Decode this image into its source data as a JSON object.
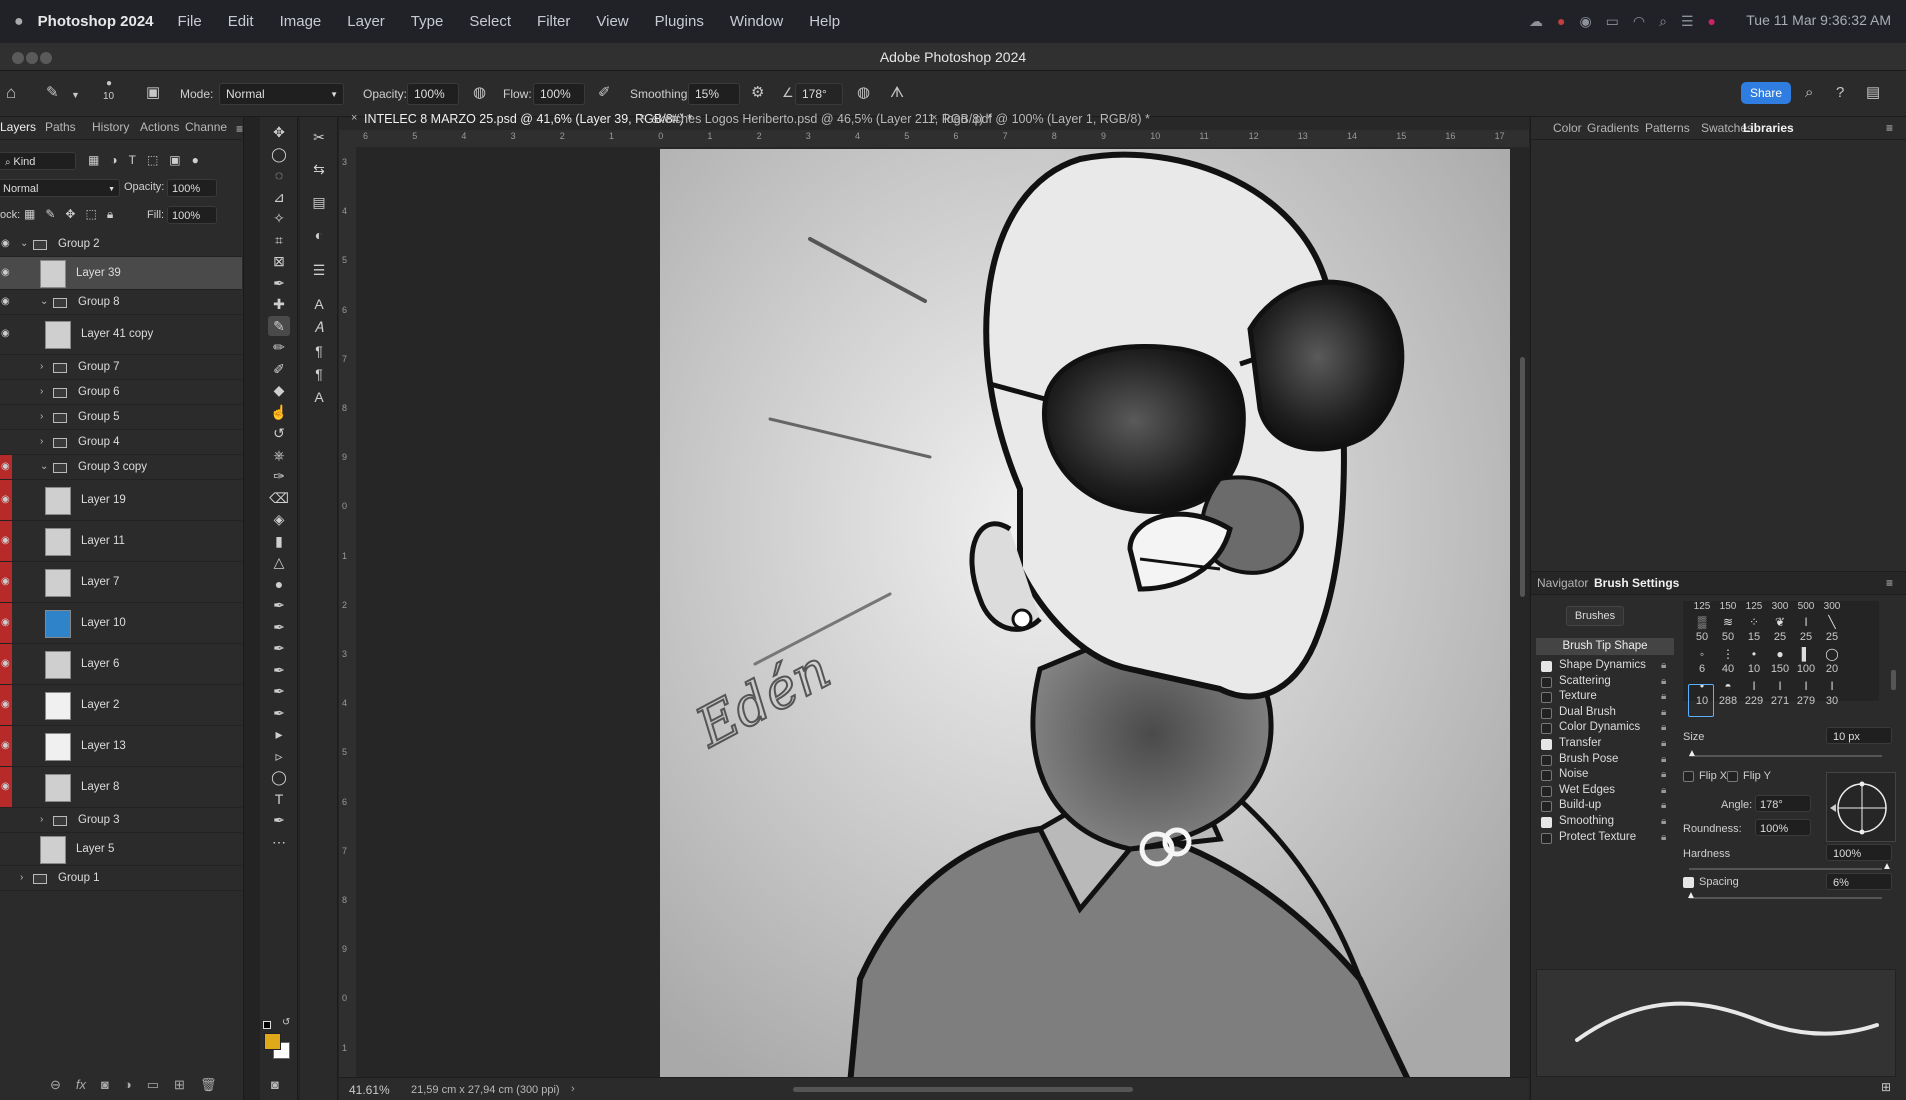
{
  "menubar": {
    "app": "Photoshop 2024",
    "items": [
      "File",
      "Edit",
      "Image",
      "Layer",
      "Type",
      "Select",
      "Filter",
      "View",
      "Plugins",
      "Window",
      "Help"
    ],
    "datetime": "Tue 11 Mar  9:36:32 AM"
  },
  "window": {
    "title": "Adobe Photoshop 2024"
  },
  "options": {
    "brush_size": "10",
    "mode_label": "Mode:",
    "mode_value": "Normal",
    "opacity_label": "Opacity:",
    "opacity_value": "100%",
    "flow_label": "Flow:",
    "flow_value": "100%",
    "smoothing_label": "Smoothing:",
    "smoothing_value": "15%",
    "angle_value": "178°",
    "share_label": "Share"
  },
  "layers_panel": {
    "tabs": [
      "Layers",
      "Paths",
      "History",
      "Actions",
      "Channe"
    ],
    "kind_label": "Kind",
    "blend_mode": "Normal",
    "opacity_label": "Opacity:",
    "opacity_value": "100%",
    "lock_label": "ock:",
    "fill_label": "Fill:",
    "fill_value": "100%",
    "layers": [
      {
        "name": "Group 2",
        "type": "group",
        "indent": 0,
        "open": true,
        "eye": true,
        "red": false
      },
      {
        "name": "Layer 39",
        "type": "layer",
        "indent": 1,
        "selected": true,
        "eye": true,
        "red": false
      },
      {
        "name": "Group 8",
        "type": "group",
        "indent": 1,
        "open": true,
        "eye": true,
        "red": false
      },
      {
        "name": "Layer 41 copy",
        "type": "layer",
        "indent": 2,
        "eye": true,
        "red": false
      },
      {
        "name": "Group 7",
        "type": "group",
        "indent": 1,
        "open": false,
        "eye": false,
        "red": false
      },
      {
        "name": "Group 6",
        "type": "group",
        "indent": 1,
        "open": false,
        "eye": false,
        "red": false
      },
      {
        "name": "Group 5",
        "type": "group",
        "indent": 1,
        "open": false,
        "eye": false,
        "red": false
      },
      {
        "name": "Group 4",
        "type": "group",
        "indent": 1,
        "open": false,
        "eye": false,
        "red": false
      },
      {
        "name": "Group 3 copy",
        "type": "group",
        "indent": 1,
        "open": true,
        "eye": true,
        "red": true
      },
      {
        "name": "Layer 19",
        "type": "layer",
        "indent": 2,
        "eye": true,
        "red": true
      },
      {
        "name": "Layer 11",
        "type": "layer",
        "indent": 2,
        "eye": true,
        "red": true
      },
      {
        "name": "Layer 7",
        "type": "layer",
        "indent": 2,
        "eye": true,
        "red": true
      },
      {
        "name": "Layer 10",
        "type": "layer",
        "indent": 2,
        "eye": true,
        "red": true
      },
      {
        "name": "Layer 6",
        "type": "layer",
        "indent": 2,
        "eye": true,
        "red": true
      },
      {
        "name": "Layer 2",
        "type": "layer",
        "indent": 2,
        "eye": true,
        "red": true
      },
      {
        "name": "Layer 13",
        "type": "layer",
        "indent": 2,
        "eye": true,
        "red": true
      },
      {
        "name": "Layer 8",
        "type": "layer",
        "indent": 2,
        "eye": true,
        "red": true
      },
      {
        "name": "Group 3",
        "type": "group",
        "indent": 1,
        "open": false,
        "eye": false,
        "red": false
      },
      {
        "name": "Layer 5",
        "type": "layer",
        "indent": 1,
        "eye": false,
        "red": false
      },
      {
        "name": "Group 1",
        "type": "group",
        "indent": 0,
        "open": false,
        "eye": false,
        "red": false
      }
    ]
  },
  "documents": {
    "tabs": [
      "INTELEC 8 MARZO 25.psd @ 41,6% (Layer 39, RGB/8#) *",
      "sketches Logos Heriberto.psd @ 46,5% (Layer 211, RGB/8) *",
      "logo .pdf @ 100% (Layer 1, RGB/8) *"
    ],
    "ruler_h": [
      "6",
      "5",
      "4",
      "3",
      "2",
      "1",
      "0",
      "1",
      "2",
      "3",
      "4",
      "5",
      "6",
      "7",
      "8",
      "9",
      "10",
      "11",
      "12",
      "13",
      "14",
      "15",
      "16",
      "17"
    ],
    "ruler_v": [
      "3",
      "4",
      "5",
      "6",
      "7",
      "8",
      "9",
      "0",
      "1",
      "2",
      "3",
      "4",
      "5",
      "6",
      "7",
      "8",
      "9",
      "0",
      "1"
    ],
    "artwork_signature": "Edén",
    "zoom": "41.61%",
    "doc_info": "21,59 cm x 27,94 cm (300 ppi)"
  },
  "right_panel": {
    "top_tabs": [
      "Color",
      "Gradients",
      "Patterns",
      "Swatches",
      "Libraries"
    ],
    "bottom_tabs": [
      "Navigator",
      "Brush Settings"
    ],
    "brushes_button": "Brushes",
    "brush_tip_shape": "Brush Tip Shape",
    "settings": [
      {
        "label": "Shape Dynamics",
        "checked": true
      },
      {
        "label": "Scattering",
        "checked": false
      },
      {
        "label": "Texture",
        "checked": false
      },
      {
        "label": "Dual Brush",
        "checked": false
      },
      {
        "label": "Color Dynamics",
        "checked": false
      },
      {
        "label": "Transfer",
        "checked": true
      },
      {
        "label": "Brush Pose",
        "checked": false
      },
      {
        "label": "Noise",
        "checked": false
      },
      {
        "label": "Wet Edges",
        "checked": false
      },
      {
        "label": "Build-up",
        "checked": false
      },
      {
        "label": "Smoothing",
        "checked": true
      },
      {
        "label": "Protect Texture",
        "checked": false
      }
    ],
    "tip_top_nums": [
      "125",
      "150",
      "125",
      "300",
      "500",
      "300"
    ],
    "tip_rows": [
      [
        "50",
        "50",
        "15",
        "25",
        "25",
        "25"
      ],
      [
        "6",
        "40",
        "10",
        "150",
        "100",
        "20"
      ],
      [
        "10",
        "288",
        "229",
        "271",
        "279",
        "30"
      ]
    ],
    "size_label": "Size",
    "size_value": "10 px",
    "flip_x": "Flip X",
    "flip_y": "Flip Y",
    "angle_label": "Angle:",
    "angle_value": "178°",
    "roundness_label": "Roundness:",
    "roundness_value": "100%",
    "hardness_label": "Hardness",
    "hardness_value": "100%",
    "spacing_label": "Spacing",
    "spacing_value": "6%"
  },
  "colors": {
    "foreground": "#e0a91a",
    "accent": "#2f7de1",
    "visibility_red": "#b72a2a"
  }
}
